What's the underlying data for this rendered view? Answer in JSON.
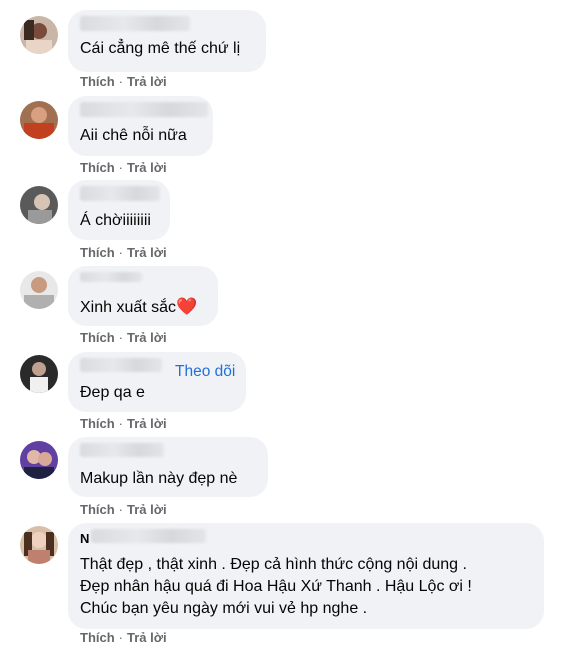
{
  "comments": [
    {
      "text": "Cái cẳng mê thế chứ lị"
    },
    {
      "text": "Aii chê nỗi nữa"
    },
    {
      "text": "Á chờiiiiiiii"
    },
    {
      "text": "Xinh xuất sắc",
      "emoji": "❤️"
    },
    {
      "text": "Đep qa e",
      "follow_label": "Theo dõi"
    },
    {
      "text": "Makup lần này đẹp nè"
    },
    {
      "name_initial": "N",
      "lines": [
        "Thật đẹp , thật xinh . Đẹp cả hình thức cộng nội dung .",
        "Đẹp nhân hậu quá đi Hoa Hậu Xứ Thanh . Hậu Lộc ơi !",
        "Chúc bạn yêu ngày mới vui vẻ hp nghe ."
      ]
    }
  ],
  "actions": {
    "like": "Thích",
    "separator": "·",
    "reply": "Trả lời"
  },
  "colors": {
    "bubble": "#f0f2f5",
    "action_text": "#65676b",
    "link": "#216fdb",
    "heart": "#e41e3f"
  }
}
